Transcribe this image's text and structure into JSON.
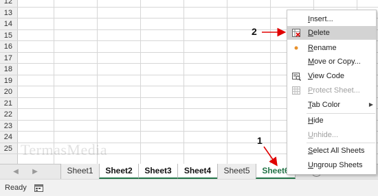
{
  "grid": {
    "rows": [
      "12",
      "13",
      "14",
      "15",
      "16",
      "17",
      "18",
      "19",
      "20",
      "21",
      "22",
      "23",
      "24",
      "25"
    ]
  },
  "watermark": "TermasMedia",
  "tabs": {
    "sheets": [
      {
        "label": "Sheet1",
        "style": "normal"
      },
      {
        "label": "Sheet2",
        "style": "bold"
      },
      {
        "label": "Sheet3",
        "style": "bold"
      },
      {
        "label": "Sheet4",
        "style": "bold"
      },
      {
        "label": "Sheet5",
        "style": "normal"
      },
      {
        "label": "Sheet6",
        "style": "active"
      }
    ],
    "add_icon": "+",
    "nav_prev_icon": "triangle-left-icon",
    "nav_next_icon": "triangle-right-icon"
  },
  "status": {
    "text": "Ready",
    "macro_icon": "macro-recording-icon"
  },
  "context_menu": {
    "items": [
      {
        "key": "I",
        "rest": "nsert...",
        "state": "normal",
        "icon": ""
      },
      {
        "key": "D",
        "rest": "elete",
        "state": "highlighted",
        "icon": "delete-sheet-icon"
      },
      {
        "key": "R",
        "rest": "ename",
        "state": "normal",
        "icon": "dot-icon"
      },
      {
        "key": "M",
        "rest": "ove or Copy...",
        "state": "normal",
        "icon": ""
      },
      {
        "key": "V",
        "rest": "iew Code",
        "state": "normal",
        "icon": "view-code-icon"
      },
      {
        "key": "P",
        "rest": "rotect Sheet...",
        "state": "disabled",
        "icon": "protect-sheet-icon"
      },
      {
        "key": "T",
        "rest": "ab Color",
        "state": "normal",
        "icon": "",
        "submenu": true
      },
      {
        "key": "H",
        "rest": "ide",
        "state": "normal",
        "icon": ""
      },
      {
        "key": "U",
        "rest": "nhide...",
        "state": "disabled",
        "icon": ""
      },
      {
        "key": "S",
        "rest": "elect All Sheets",
        "state": "normal",
        "icon": ""
      },
      {
        "key": "U",
        "rest": "ngroup Sheets",
        "state": "normal",
        "icon": ""
      }
    ]
  },
  "annotations": {
    "step1": "1",
    "step2": "2",
    "arrow_color": "#e00000"
  }
}
